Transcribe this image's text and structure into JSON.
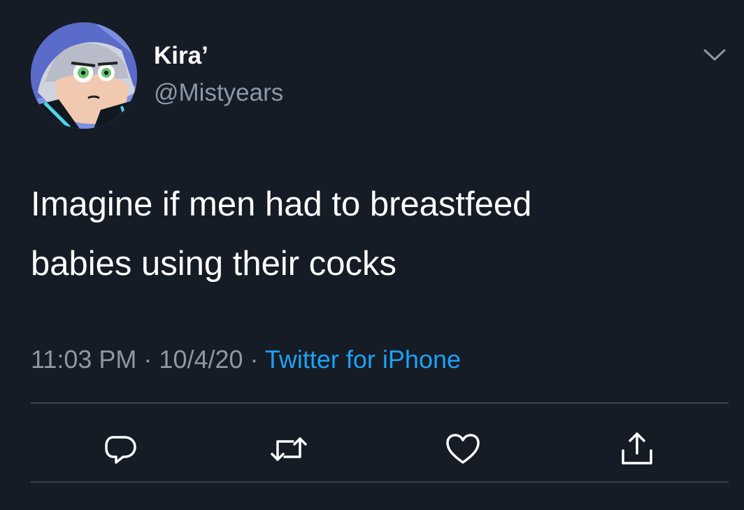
{
  "user": {
    "display_name": "Kira’",
    "handle": "@Mistyears"
  },
  "tweet": {
    "lines": [
      "Imagine if men had to breastfeed",
      "babies using their cocks"
    ],
    "time": "11:03 PM",
    "date": "10/4/20",
    "separator": " · ",
    "source": "Twitter for iPhone"
  },
  "icons": {
    "more": "chevron-down-icon",
    "reply": "reply-icon",
    "retweet": "retweet-icon",
    "like": "heart-icon",
    "share": "share-icon"
  },
  "colors": {
    "background": "#151c26",
    "text": "#ffffff",
    "muted": "#8b98a5",
    "link": "#1da1f2",
    "divider": "#38444d"
  }
}
